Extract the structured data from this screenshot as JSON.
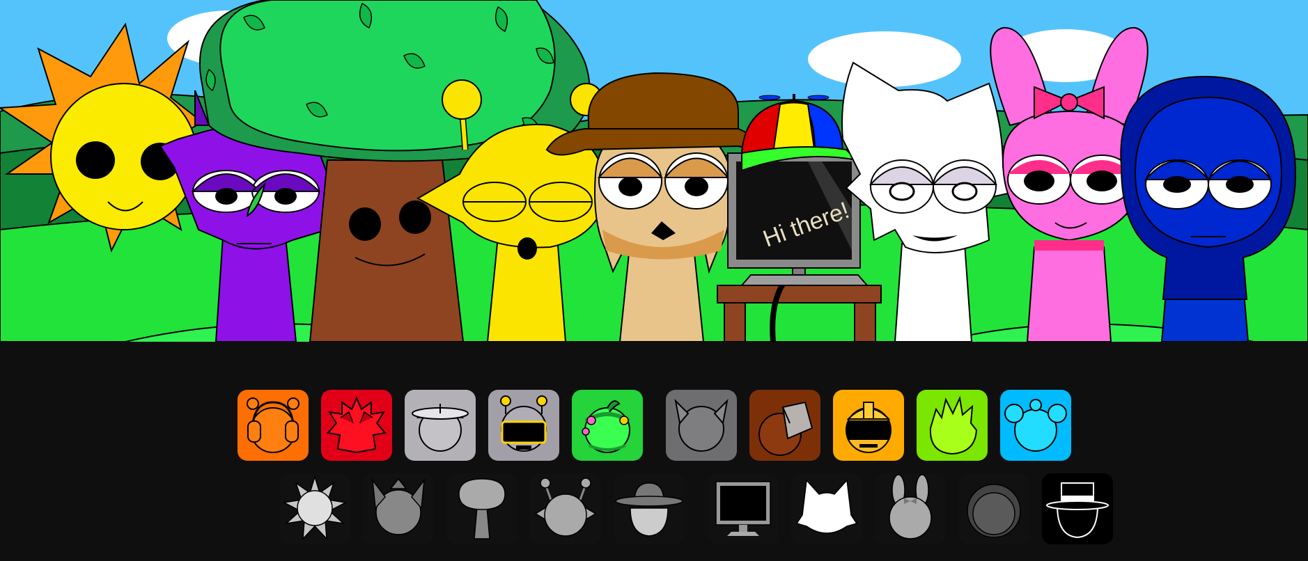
{
  "scene": {
    "speech_text": "Hi there!",
    "colors": {
      "sky": "#55c3fb",
      "hill_back": "#1e9a4a",
      "hill_front": "#22e33a",
      "sun": "#fbeb00",
      "sun_rays": "#ff9a0c",
      "purple": "#8e12e8",
      "tree_leaves": "#1fd65c",
      "tree_trunk": "#8e4420",
      "yellow": "#fbe500",
      "tan": "#e8c48a",
      "hat_brown": "#834700",
      "white": "#ffffff",
      "pink": "#ff6ee0",
      "navy": "#002aa8"
    },
    "characters": [
      {
        "id": "sun",
        "icon": "sun-character-icon"
      },
      {
        "id": "purple",
        "icon": "purple-leaf-character-icon"
      },
      {
        "id": "tree",
        "icon": "tree-character-icon"
      },
      {
        "id": "yellow",
        "icon": "yellow-antenna-character-icon"
      },
      {
        "id": "tan",
        "icon": "brown-hat-character-icon"
      },
      {
        "id": "computer",
        "icon": "computer-character-icon"
      },
      {
        "id": "white",
        "icon": "white-cat-character-icon"
      },
      {
        "id": "pink",
        "icon": "pink-bunny-character-icon"
      },
      {
        "id": "navy",
        "icon": "navy-hood-character-icon"
      }
    ]
  },
  "palette": {
    "costumes": [
      {
        "id": "headphones",
        "icon": "orange-headphones-costume-icon",
        "bg": "#ff6e00"
      },
      {
        "id": "spiky",
        "icon": "red-spiky-costume-icon",
        "bg": "#e20018"
      },
      {
        "id": "propeller",
        "icon": "gray-propeller-costume-icon",
        "bg": "#b3b1b6"
      },
      {
        "id": "robot",
        "icon": "gray-robot-costume-icon",
        "bg": "#a29fa8"
      },
      {
        "id": "flower",
        "icon": "green-flower-costume-icon",
        "bg": "#25d33a"
      },
      {
        "id": "horns",
        "icon": "gray-horns-costume-icon",
        "bg": "#6e6e70"
      },
      {
        "id": "bucket",
        "icon": "brown-bucket-costume-icon",
        "bg": "#7d3008"
      },
      {
        "id": "helmet",
        "icon": "yellow-helmet-costume-icon",
        "bg": "#ffaa00"
      },
      {
        "id": "lime",
        "icon": "lime-spiky-costume-icon",
        "bg": "#7be600"
      },
      {
        "id": "ears",
        "icon": "cyan-ears-costume-icon",
        "bg": "#00bbff"
      }
    ],
    "silhouettes": [
      {
        "id": "sun",
        "icon": "sun-silhouette-icon"
      },
      {
        "id": "purple",
        "icon": "horned-silhouette-icon"
      },
      {
        "id": "tree",
        "icon": "tree-silhouette-icon"
      },
      {
        "id": "yellow",
        "icon": "antenna-silhouette-icon"
      },
      {
        "id": "tan",
        "icon": "hat-silhouette-icon"
      },
      {
        "id": "computer",
        "icon": "monitor-silhouette-icon"
      },
      {
        "id": "white",
        "icon": "cat-silhouette-icon"
      },
      {
        "id": "pink",
        "icon": "bunny-silhouette-icon"
      },
      {
        "id": "navy",
        "icon": "hood-silhouette-icon"
      },
      {
        "id": "tophat",
        "icon": "tophat-silhouette-icon"
      }
    ]
  }
}
